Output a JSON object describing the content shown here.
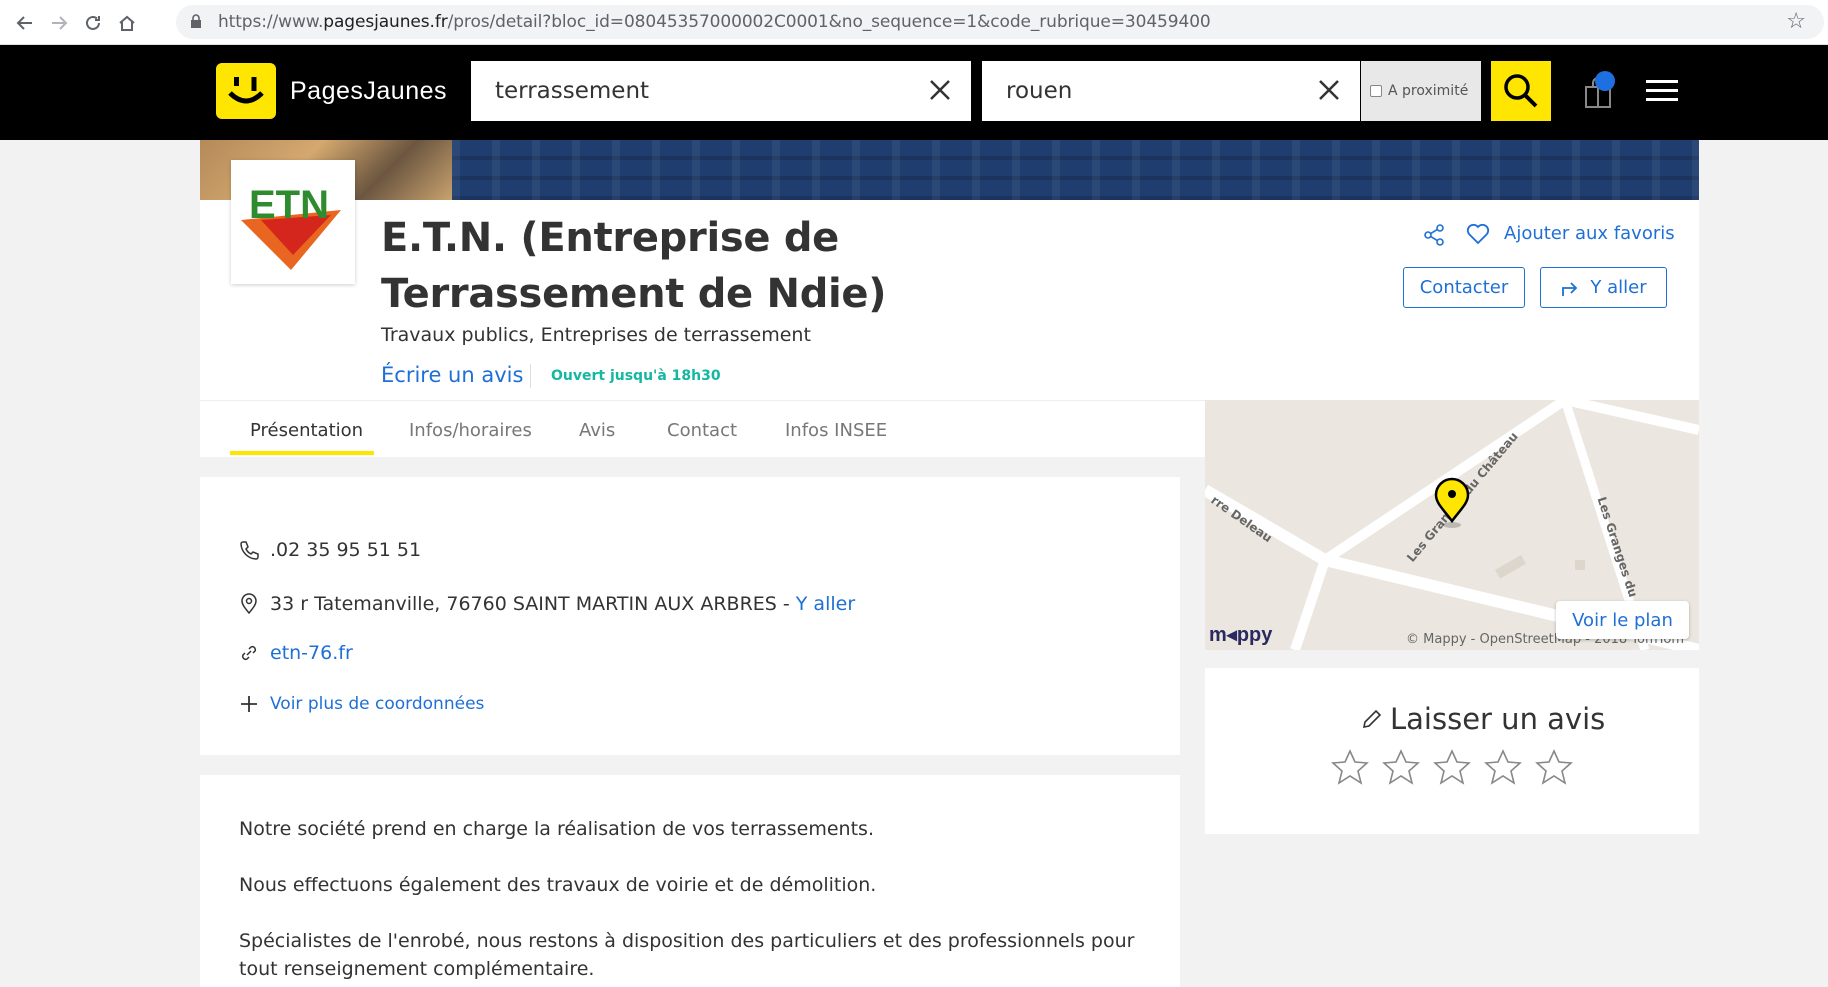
{
  "browser": {
    "url_prefix": "https://www.",
    "url_host": "pagesjaunes.fr",
    "url_path": "/pros/detail?bloc_id=08045357000002C0001&no_sequence=1&code_rubrique=30459400"
  },
  "header": {
    "brand": "PagesJaunes",
    "search_what": "terrassement",
    "search_where": "rouen",
    "proximity_label": "A proximité"
  },
  "company": {
    "name_line1": "E.T.N. (Entreprise de",
    "name_line2": "Terrassement de Ndie)",
    "category1": "Travaux publics,",
    "category2": " Entreprises de terrassement",
    "write_review": "Écrire un avis",
    "open_status": "Ouvert jusqu'à 18h30",
    "add_favorites": "Ajouter aux favoris",
    "contact_btn": "Contacter",
    "directions_btn": "Y aller",
    "logo_text": "ETN"
  },
  "tabs": [
    {
      "label": "Présentation"
    },
    {
      "label": "Infos/horaires"
    },
    {
      "label": "Avis"
    },
    {
      "label": "Contact"
    },
    {
      "label": "Infos INSEE"
    }
  ],
  "map": {
    "view_plan": "Voir le plan",
    "brand": "m◂ppy",
    "credit": "© Mappy - OpenStreetMap - 2018 TomTom",
    "road1": "Les Granges du Château",
    "road2": "rre Deleau",
    "road3": "Les Granges du"
  },
  "contact": {
    "phone": ".02 35 95 51 51",
    "address": "33 r Tatemanville, 76760 SAINT MARTIN AUX ARBRES",
    "address_sep": " - ",
    "address_link": "Y aller",
    "website": "etn-76.fr",
    "more": "Voir plus de coordonnées"
  },
  "description": {
    "p1": "Notre société prend en charge la réalisation de vos terrassements.",
    "p2": "Nous effectuons également des travaux de voirie et de démolition.",
    "p3": "Spécialistes de l'enrobé, nous restons à disposition des particuliers et des professionnels pour tout renseignement complémentaire."
  },
  "review": {
    "title": "Laisser un avis",
    "stars_max": 5
  },
  "colors": {
    "brand_yellow": "#ffe600",
    "link_blue": "#1e6fd6",
    "open_green": "#14b8a0"
  }
}
